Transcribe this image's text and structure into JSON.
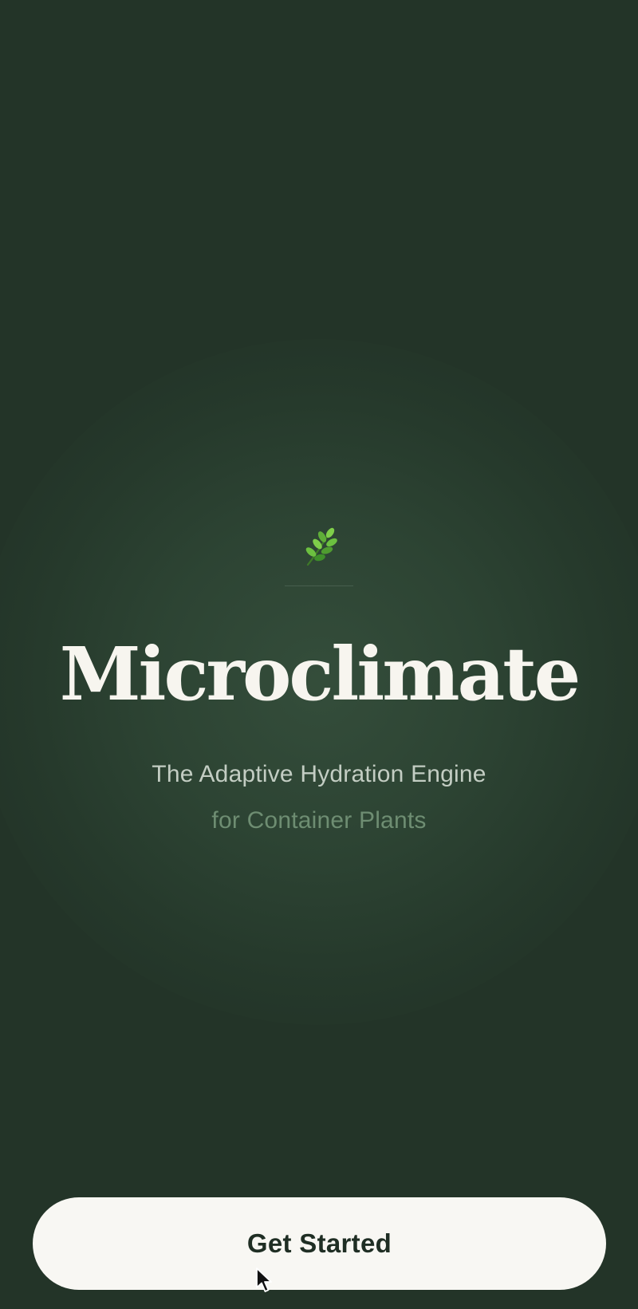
{
  "app": {
    "title": "Microclimate",
    "tagline_line1": "The Adaptive Hydration Engine",
    "tagline_line2": "for Container Plants",
    "logo_icon": "sprig-icon"
  },
  "actions": {
    "get_started_label": "Get Started"
  },
  "colors": {
    "background": "#233428",
    "glow": "#3a5642",
    "title": "#f7f5ef",
    "subtitle_primary": "#c3cdc3",
    "subtitle_secondary": "#6e8d72",
    "button_bg": "#f8f7f3",
    "button_text": "#1f2e24",
    "leaf_light": "#7fcf4a",
    "leaf_dark": "#3f8f2a"
  }
}
